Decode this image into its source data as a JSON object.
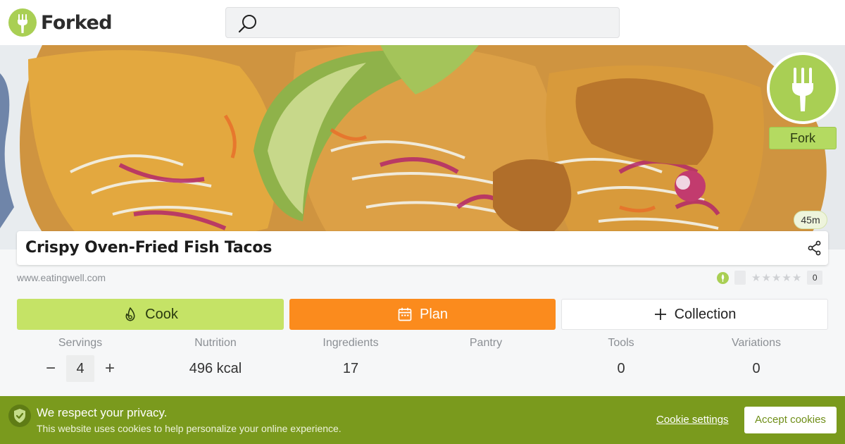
{
  "brand": {
    "name": "Forked",
    "accent": "#a9cf54"
  },
  "search": {
    "placeholder": ""
  },
  "recipe": {
    "title": "Crispy Oven-Fried Fish Tacos",
    "source": "www.eatingwell.com",
    "time": "45m",
    "rating_count": "0",
    "stars": 0
  },
  "fork_button": {
    "label": "Fork"
  },
  "actions": {
    "cook_label": "Cook",
    "plan_label": "Plan",
    "collection_label": "Collection"
  },
  "stats": {
    "servings": {
      "label": "Servings",
      "value": "4",
      "minus": "−",
      "plus": "+"
    },
    "nutrition": {
      "label": "Nutrition",
      "value": "496 kcal"
    },
    "ingredients": {
      "label": "Ingredients",
      "value": "17"
    },
    "pantry": {
      "label": "Pantry",
      "value": ""
    },
    "tools": {
      "label": "Tools",
      "value": "0"
    },
    "variations": {
      "label": "Variations",
      "value": "0"
    }
  },
  "cookie_banner": {
    "title": "We respect your privacy.",
    "text": "This website uses cookies to help personalize your online experience.",
    "settings_label": "Cookie settings",
    "accept_label": "Accept cookies"
  },
  "colors": {
    "cook": "#c5e366",
    "plan": "#fb8b1d",
    "banner": "#7a9a1d"
  },
  "icons": [
    "fork-logo-icon",
    "search-icon",
    "share-icon",
    "fire-icon",
    "calendar-icon",
    "plus-icon",
    "shield-check-icon",
    "leaf-icon",
    "star-icon"
  ]
}
